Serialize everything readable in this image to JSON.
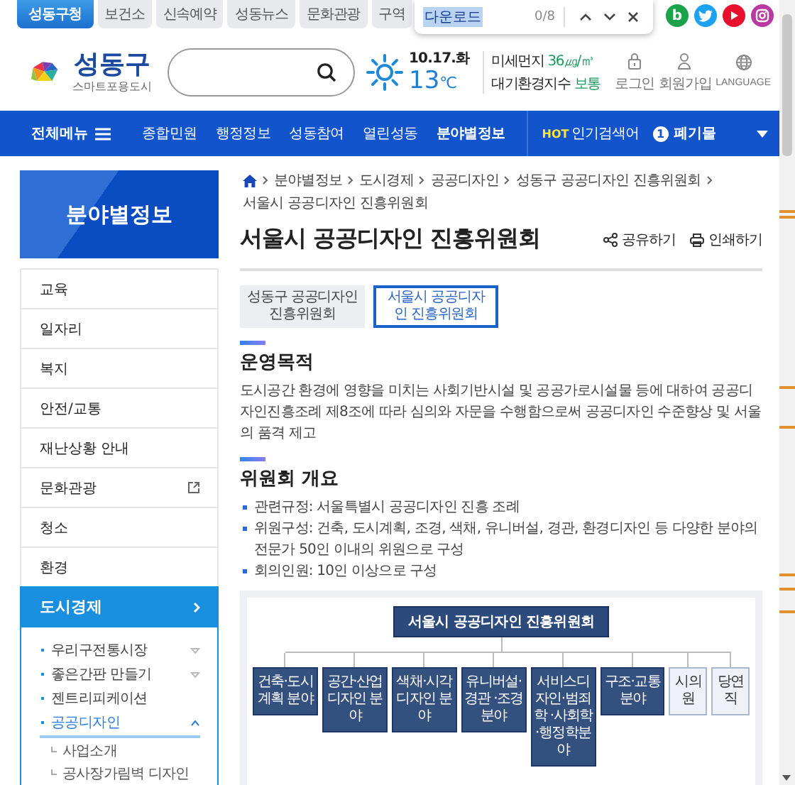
{
  "top_tabs": [
    {
      "label": "성동구청",
      "selected": true
    },
    {
      "label": "보건소",
      "selected": false
    },
    {
      "label": "신속예약",
      "selected": false
    },
    {
      "label": "성동뉴스",
      "selected": false
    },
    {
      "label": "문화관광",
      "selected": false
    },
    {
      "label": "구역",
      "selected": false
    }
  ],
  "find_bar": {
    "query": "다운로드",
    "count": "0/8"
  },
  "social": [
    {
      "kind": "blog",
      "glyph": "b",
      "color": "#1aa34a"
    },
    {
      "kind": "twitter",
      "color": "#1da1f2"
    },
    {
      "kind": "youtube",
      "color": "#e8112d"
    },
    {
      "kind": "instagram",
      "color": "#b83aa0"
    }
  ],
  "logo": {
    "name": "성동구",
    "tagline": "스마트포용도시"
  },
  "weather": {
    "date": "10.17.화",
    "temperature": "13",
    "unit": "℃",
    "dust_label": "미세먼지",
    "dust_value": "36㎍/㎥",
    "air_label": "대기환경지수",
    "air_value": "보통"
  },
  "user_links": [
    {
      "kind": "lock",
      "label": "로그인"
    },
    {
      "kind": "person",
      "label": "회원가입"
    },
    {
      "kind": "globe",
      "label": "LANGUAGE"
    }
  ],
  "nav": {
    "menu_label": "전체메뉴",
    "items": [
      {
        "label": "종합민원",
        "selected": false
      },
      {
        "label": "행정정보",
        "selected": false
      },
      {
        "label": "성동참여",
        "selected": false
      },
      {
        "label": "열린성동",
        "selected": false
      },
      {
        "label": "분야별정보",
        "selected": true
      }
    ],
    "hot": {
      "tag": "HOT",
      "label": "인기검색어",
      "rank": "1",
      "keyword": "폐기물"
    }
  },
  "sidebar": {
    "title": "분야별정보",
    "items": [
      {
        "label": "교육",
        "selected": false,
        "external": false
      },
      {
        "label": "일자리",
        "selected": false,
        "external": false
      },
      {
        "label": "복지",
        "selected": false,
        "external": false
      },
      {
        "label": "안전/교통",
        "selected": false,
        "external": false
      },
      {
        "label": "재난상황 안내",
        "selected": false,
        "external": false
      },
      {
        "label": "문화관광",
        "selected": false,
        "external": true
      },
      {
        "label": "청소",
        "selected": false,
        "external": false
      },
      {
        "label": "환경",
        "selected": false,
        "external": false
      },
      {
        "label": "도시경제",
        "selected": true,
        "external": false,
        "children": [
          {
            "label": "우리구전통시장",
            "selected": false,
            "expanded": false
          },
          {
            "label": "좋은간판 만들기",
            "selected": false,
            "expanded": false
          },
          {
            "label": "젠트리피케이션",
            "selected": false
          },
          {
            "label": "공공디자인",
            "selected": true,
            "expanded": true,
            "children": [
              {
                "label": "사업소개"
              },
              {
                "label": "공사장가림벽 디자인"
              }
            ]
          }
        ]
      }
    ]
  },
  "breadcrumb": [
    "분야별정보",
    "도시경제",
    "공공디자인",
    "성동구 공공디자인 진흥위원회",
    "서울시 공공디자인 진흥위원회"
  ],
  "page_title": "서울시 공공디자인 진흥위원회",
  "actions": [
    {
      "kind": "share",
      "label": "공유하기"
    },
    {
      "kind": "print",
      "label": "인쇄하기"
    }
  ],
  "sub_tabs": [
    {
      "label": "성동구 공공디자인 진흥위원회",
      "selected": false
    },
    {
      "label": "서울시 공공디자인 진흥위원회",
      "selected": true
    }
  ],
  "sections": [
    {
      "heading": "운영목적",
      "kind": "paragraph",
      "text": "도시공간 환경에 영향을 미치는 사회기반시설 및 공공가로시설물 등에 대하여 공공디자인진흥조례 제8조에 따라 심의와 자문을 수행함으로써 공공디자인 수준향상 및 서울의 품격 제고"
    },
    {
      "heading": "위원회 개요",
      "kind": "bullets",
      "items": [
        "관련규정: 서울특별시 공공디자인 진흥 조례",
        "위원구성: 건축, 도시계획, 조경, 색채, 유니버설, 경관, 환경디자인 등 다양한 분야의 전문가 50인 이내의 위원으로 구성",
        "회의인원: 10인 이상으로 구성"
      ]
    }
  ],
  "org_chart": {
    "root": "서울시 공공디자인 진흥위원회",
    "branches": [
      {
        "label": "건축·도시계획 분야",
        "kind": "field"
      },
      {
        "label": "공간·산업디자인 분야",
        "kind": "field"
      },
      {
        "label": "색채·시각디자인 분야",
        "kind": "field"
      },
      {
        "label": "유니버설·경관 ·조경분야",
        "kind": "field"
      },
      {
        "label": "서비스디자인·범죄학 ·사회학·행정학분야",
        "kind": "field"
      },
      {
        "label": "구조·교통분야",
        "kind": "field"
      },
      {
        "label": "시의원",
        "kind": "member"
      },
      {
        "label": "당연직",
        "kind": "member"
      }
    ]
  }
}
